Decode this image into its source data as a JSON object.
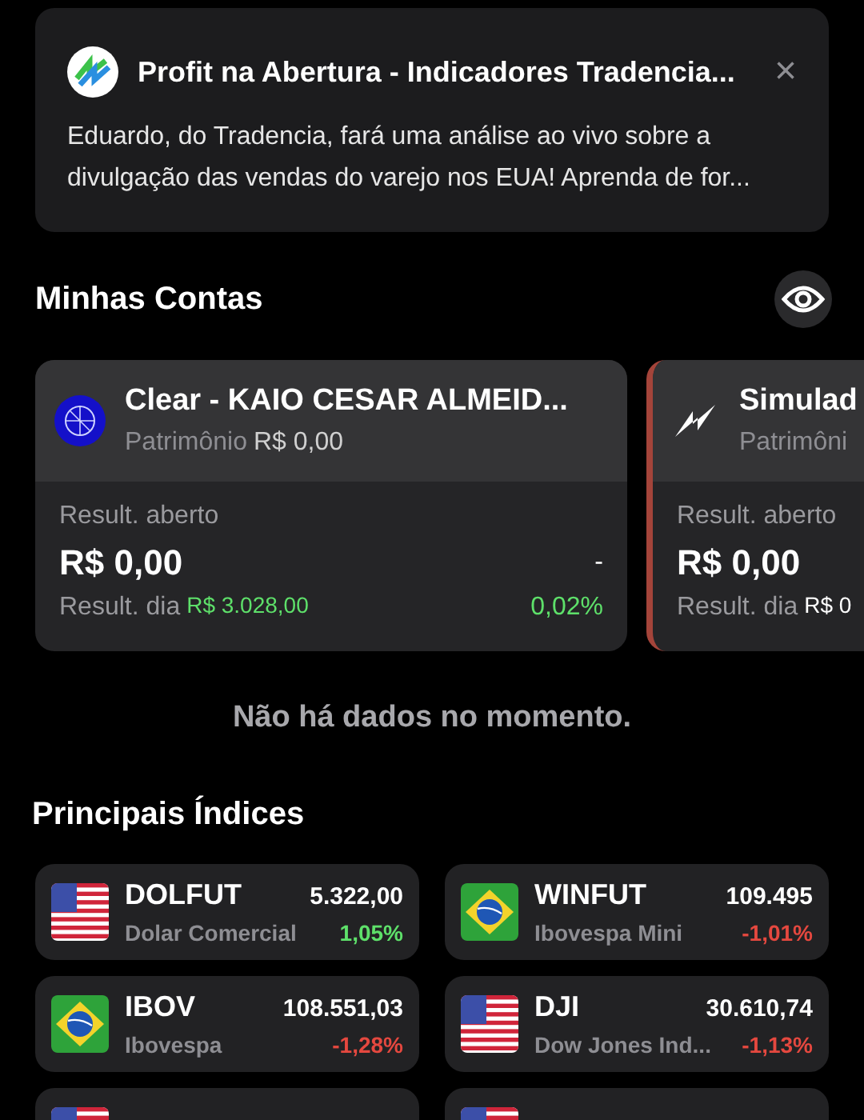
{
  "notification": {
    "title": "Profit na Abertura - Indicadores Tradencia...",
    "body": "Eduardo, do Tradencia, fará uma análise ao vivo sobre a divulgação das vendas do varejo nos EUA! Aprenda de for...",
    "close": "×"
  },
  "accounts_section": {
    "title": "Minhas Contas"
  },
  "accounts": [
    {
      "kind": "broker",
      "selected": false,
      "name": "Clear - KAIO CESAR ALMEID...",
      "equity_label": "Patrimônio",
      "equity": "R$ 0,00",
      "open_label": "Result. aberto",
      "open_value": "R$ 0,00",
      "open_change": "-",
      "day_label": "Result. dia",
      "day_value": "R$ 3.028,00",
      "day_change": "0,02%",
      "color": "#5ee06a"
    },
    {
      "kind": "simulator",
      "selected": true,
      "name": "Simulad",
      "equity_label": "Patrimôni",
      "open_label": "Result. aberto",
      "open_value": "R$ 0,00",
      "day_label": "Result. dia",
      "day_value": "R$ 0",
      "color": "#ffffff"
    }
  ],
  "empty_message": "Não há dados no momento.",
  "indices_section": {
    "title": "Principais Índices"
  },
  "indices": [
    {
      "kind": "usa",
      "symbol": "DOLFUT",
      "price": "5.322,00",
      "name": "Dolar Comercial",
      "change": "1,05%",
      "color": "#5ee06a"
    },
    {
      "kind": "brazil",
      "symbol": "WINFUT",
      "price": "109.495",
      "name": "Ibovespa Mini",
      "change": "-1,01%",
      "color": "#e5483f"
    },
    {
      "kind": "brazil",
      "symbol": "IBOV",
      "price": "108.551,03",
      "name": "Ibovespa",
      "change": "-1,28%",
      "color": "#e5483f"
    },
    {
      "kind": "usa",
      "symbol": "DJI",
      "price": "30.610,74",
      "name": "Dow Jones Ind...",
      "change": "-1,13%",
      "color": "#e5483f"
    },
    {
      "kind": "usa"
    },
    {
      "kind": "usa"
    }
  ]
}
